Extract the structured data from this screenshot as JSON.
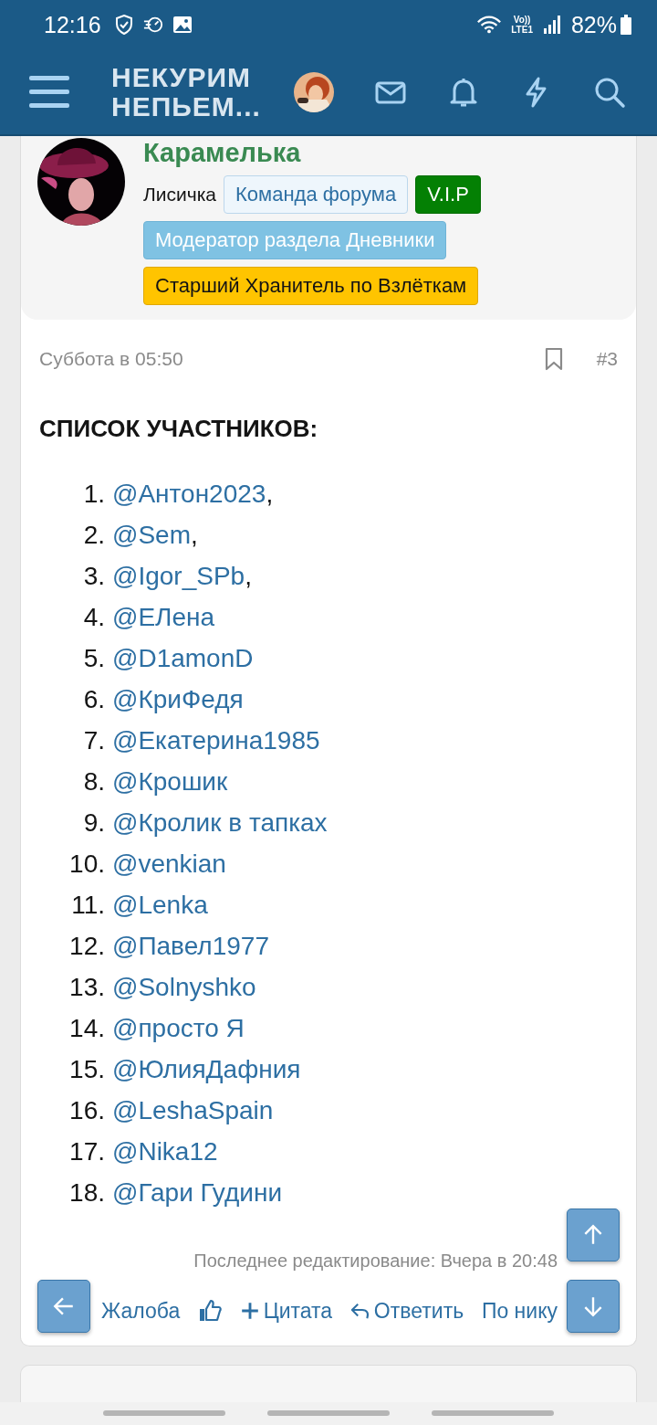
{
  "status_bar": {
    "time": "12:16",
    "network": "Vo))\nLTE1",
    "battery": "82%"
  },
  "header": {
    "logo_line_1": "НЕКУРИМ",
    "logo_line_2": "НЕПЬЕМ..."
  },
  "author": {
    "name": "Карамелька",
    "title": "Лисичка",
    "badges": [
      {
        "label": "Команда форума",
        "kind": "team"
      },
      {
        "label": "V.I.P",
        "kind": "vip"
      },
      {
        "label": "Модератор раздела Дневники",
        "kind": "moderator"
      },
      {
        "label": "Старший Хранитель по Взлёткам",
        "kind": "keeper"
      }
    ]
  },
  "post": {
    "date": "Суббота в 05:50",
    "number": "#3",
    "heading": "СПИСОК УЧАСТНИКОВ:",
    "participants": [
      {
        "number": "1.",
        "mention": "@Антон2023",
        "suffix": ","
      },
      {
        "number": "2.",
        "mention": "@Sem",
        "suffix": ","
      },
      {
        "number": "3.",
        "mention": "@Igor_SPb",
        "suffix": ","
      },
      {
        "number": "4.",
        "mention": "@ЕЛена"
      },
      {
        "number": "5.",
        "mention": "@D1amonD"
      },
      {
        "number": "6.",
        "mention": "@КриФедя"
      },
      {
        "number": "7.",
        "mention": "@Екатерина1985"
      },
      {
        "number": "8.",
        "mention": "@Крошик"
      },
      {
        "number": "9.",
        "mention": "@Кролик в тапках"
      },
      {
        "number": "10.",
        "mention": "@venkian"
      },
      {
        "number": "11.",
        "mention": "@Lenka"
      },
      {
        "number": "12.",
        "mention": "@Павел1977"
      },
      {
        "number": "13.",
        "mention": "@Solnyshko"
      },
      {
        "number": "14.",
        "mention": "@просто Я"
      },
      {
        "number": "15.",
        "mention": "@ЮлияДафния"
      },
      {
        "number": "16.",
        "mention": "@LeshaSpain"
      },
      {
        "number": "17.",
        "mention": "@Nika12"
      },
      {
        "number": "18.",
        "mention": "@Гари Гудини"
      }
    ],
    "last_edit": "Последнее редактирование: Вчера в 20:48",
    "actions": {
      "report": "Жалоба",
      "quote": "Цитата",
      "reply": "Ответить",
      "by_nick": "По нику"
    }
  }
}
